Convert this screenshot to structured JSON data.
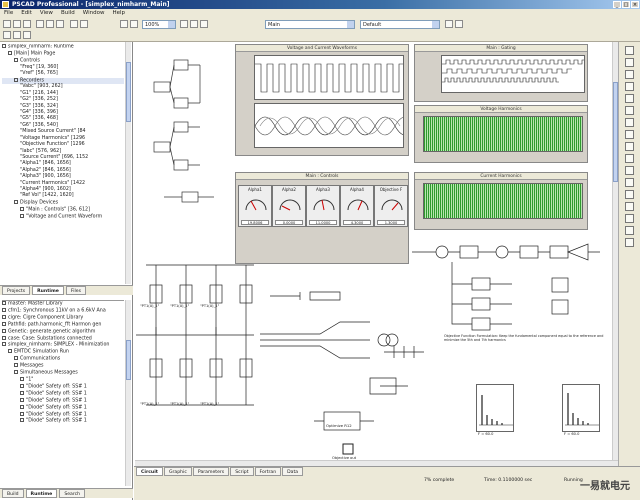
{
  "window": {
    "title": "PSCAD Professional - [simplex_nimharm_Main]"
  },
  "menu": [
    "File",
    "Edit",
    "View",
    "Build",
    "Window",
    "Help"
  ],
  "toolbar": {
    "zoom": "100%",
    "combo_main": "Main",
    "combo_component": "Default"
  },
  "workspace_tree": {
    "root": "simplex_nimharm: Runtime",
    "items": [
      "[Main] Main Page",
      "Controls",
      "\"Freq\" [19, 360]",
      "\"Vref\" [56, 765]",
      "Recorders",
      "\"Vabc\" [903, 262]",
      "\"G1\" [216, 144]",
      "\"G2\" [336, 252]",
      "\"G3\" [336, 324]",
      "\"G4\" [336, 396]",
      "\"G5\" [336, 468]",
      "\"G6\" [336, 540]",
      "\"Mixed Source Current\" [84",
      "\"Voltage Harmonics\" [1296",
      "\"Objective Function\" [1296",
      "\"Iabc\" [576, 962]",
      "\"Source Current\" [696, 1152",
      "\"Alpha1\" [846, 1656]",
      "\"Alpha2\" [846, 1656]",
      "\"Alpha3\" [900, 1656]",
      "\"Current Harmonics\" [1422",
      "\"Alpha4\" [900, 1602]",
      "\"Ref Vol\" [1422, 1620]",
      "Display Devices",
      "\"Main : Controls\" [36, 612]",
      "\"Voltage and Current Waveform"
    ]
  },
  "upper_tabs": [
    "Projects",
    "Runtime",
    "Files"
  ],
  "library_tree": {
    "items": [
      "master: Master Library",
      "cfm1: Synchronous 11kV on a 6.6kV Ana",
      "cigre: Cigre Component Library",
      "Pathfid: path.harmonic_fft Harmon gen",
      "Genetic: generate.genetic algorithm",
      "case: Case: Substations connected",
      "simplex_nimharm: SIMPLEX - Minimization",
      "EMTDC Simulation Run",
      "Communications",
      "Messages",
      "Simultaneous Messages",
      "\"1\"",
      "\"Diode\" Safety off: SS# 1",
      "\"Diode\" Safety off: SS# 1",
      "\"Diode\" Safety off: SS# 1",
      "\"Diode\" Safety off: SS# 1",
      "\"Diode\" Safety off: SS# 1",
      "\"Diode\" Safety off: SS# 1"
    ]
  },
  "lower_tabs": [
    "Build",
    "Runtime",
    "Search"
  ],
  "canvas": {
    "panel_waveforms": "Voltage and Current Waveforms",
    "panel_gates": "Main : Gating",
    "panel_voltage_harmonics": "Voltage Harmonics",
    "panel_controls": "Main : Controls",
    "panel_current_harmonics": "Current Harmonics",
    "meters": [
      {
        "label": "Alpha1",
        "value": "19.8006"
      },
      {
        "label": "Alpha2",
        "value": "0.0000"
      },
      {
        "label": "Alpha3",
        "value": "11.0000"
      },
      {
        "label": "Alpha4",
        "value": "4.3000"
      },
      {
        "label": "Objective F",
        "value": "1.3000"
      }
    ],
    "objective_note": "Objective Function Formulation: Keep the fundamental component equal to the reference and minimize the 5th and 7th harmonics",
    "optimizer_label": "Optimize R12",
    "objective_out": "Objective out",
    "fft_label_1": "F = 60.0",
    "fft_label_2": "F = 60.0",
    "switch_labels": [
      "\"PT1(A)_1\"",
      "\"PT1(A)_1\"",
      "\"PT1(A)_1\"",
      "\"PT1(A)_1\"",
      "\"PT1(A)_1\"",
      "\"PT1(A)_1\""
    ]
  },
  "bottom_tabs": [
    "Circuit",
    "Graphic",
    "Parameters",
    "Script",
    "Fortran",
    "Data"
  ],
  "status": {
    "progress": "7% complete",
    "time": "Time: 0.1100000 sec",
    "mode": "Running"
  },
  "watermark": "一易就电元"
}
